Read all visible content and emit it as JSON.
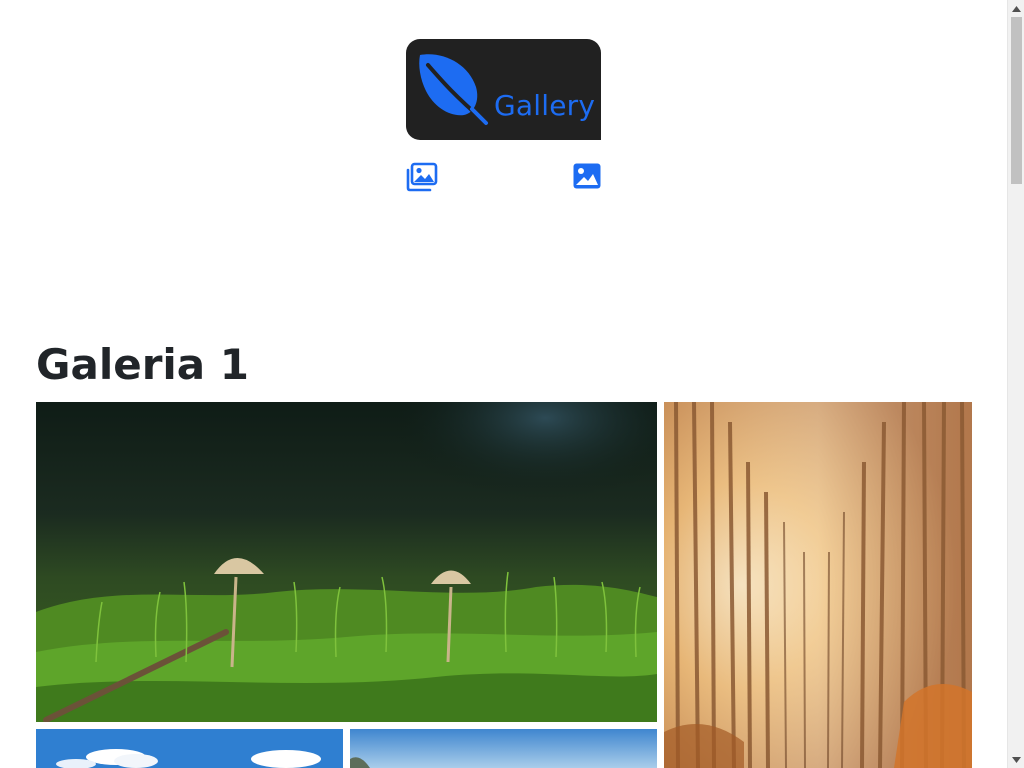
{
  "header": {
    "logo_text": "Gallery",
    "logo_icon": "leaf-icon",
    "accent_color": "#1d6cf2",
    "logo_background": "#212121"
  },
  "nav": {
    "items": [
      {
        "icon": "images-icon"
      },
      {
        "icon": "image-icon"
      }
    ]
  },
  "gallery": {
    "title": "Galeria 1",
    "photos": [
      {
        "subject": "moss-mushrooms"
      },
      {
        "subject": "sunlit-pine-forest"
      },
      {
        "subject": "blue-sky-clouds"
      },
      {
        "subject": "coastal-sky"
      }
    ]
  }
}
